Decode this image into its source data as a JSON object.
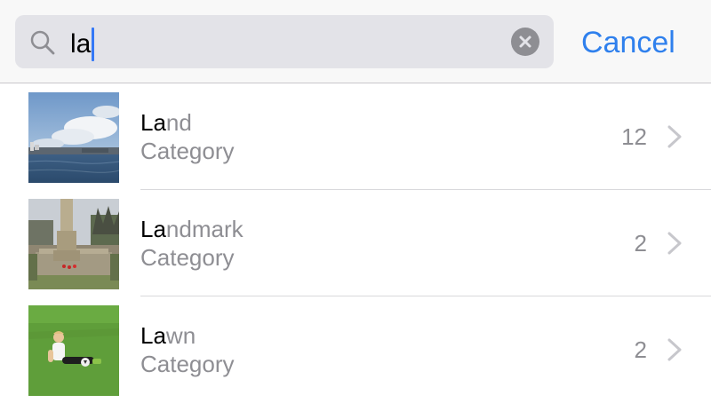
{
  "search": {
    "query": "la",
    "cancel_label": "Cancel"
  },
  "results": [
    {
      "title_match": "La",
      "title_rest": "nd",
      "subtitle": "Category",
      "count": "12",
      "thumbnail": "harbor-sky-photo"
    },
    {
      "title_match": "La",
      "title_rest": "ndmark",
      "subtitle": "Category",
      "count": "2",
      "thumbnail": "war-memorial-photo"
    },
    {
      "title_match": "La",
      "title_rest": "wn",
      "subtitle": "Category",
      "count": "2",
      "thumbnail": "child-on-lawn-photo"
    }
  ],
  "colors": {
    "accent": "#2f80ed",
    "caret": "#3478f6",
    "secondary_text": "#8e8e93",
    "search_field": "#e3e3e8"
  }
}
